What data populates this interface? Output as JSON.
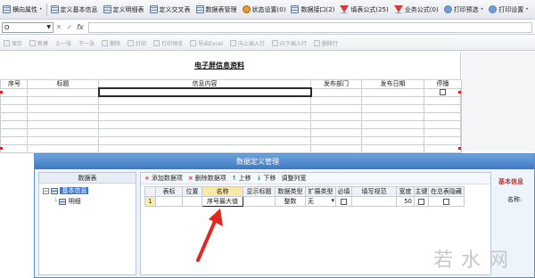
{
  "toolbar1": {
    "items": [
      {
        "icon": "grid-icon",
        "label": "横向属性",
        "caret": "•"
      },
      {
        "icon": "grid-icon",
        "label": "定义基本信息"
      },
      {
        "icon": "grid-icon",
        "label": "定义明细表"
      },
      {
        "icon": "grid-icon",
        "label": "定义交叉表"
      },
      {
        "icon": "grid-icon",
        "label": "数据表管理"
      },
      {
        "icon": "gear-icon",
        "label": "状态设置(0)"
      },
      {
        "icon": "grid-icon",
        "label": "数据接口(2)"
      },
      {
        "icon": "funnel-icon",
        "label": "填表公式(25)"
      },
      {
        "icon": "funnel-icon",
        "label": "业务公式(0)"
      },
      {
        "icon": "print-icon",
        "label": "打印预选",
        "caret": "•"
      },
      {
        "icon": "print-icon",
        "label": "打印设置",
        "caret": "•"
      }
    ]
  },
  "formula_bar": {
    "cell_ref": "O",
    "cancel": "✕",
    "confirm": "✓",
    "fx": "fx"
  },
  "toolbar3": {
    "items": [
      "保存",
      "新建",
      "上一张",
      "下一张",
      "删除",
      "打印",
      "打印预览",
      "导出Excel",
      "向上插入行",
      "向下插入行",
      "删除行"
    ]
  },
  "sheet": {
    "title": "电子屏信息资料",
    "headers": [
      "序号",
      "标题",
      "信息内容",
      "发布部门",
      "发布日期",
      "停播"
    ]
  },
  "dialog": {
    "title": "数据定义管理",
    "tree": {
      "header": "数据表",
      "root": "基本信息",
      "root_expander": "−",
      "child": "明细"
    },
    "toolbar": {
      "add": "添加数据项",
      "delete": "删除数据项",
      "up": "上移",
      "down": "下移",
      "adjust": "调整列宽"
    },
    "table": {
      "headers": [
        "",
        "表标",
        "位置",
        "名称",
        "显示标题",
        "数据类型",
        "扩展类型",
        "必填",
        "填写规范",
        "宽度",
        "主键",
        "在总表隐藏"
      ],
      "row": {
        "num": "1",
        "name": "序号最大值",
        "type": "整数",
        "ext": "无",
        "width": "50"
      }
    },
    "right": {
      "heading": "基本信息",
      "label": "名称:"
    }
  },
  "watermark": "若水网"
}
